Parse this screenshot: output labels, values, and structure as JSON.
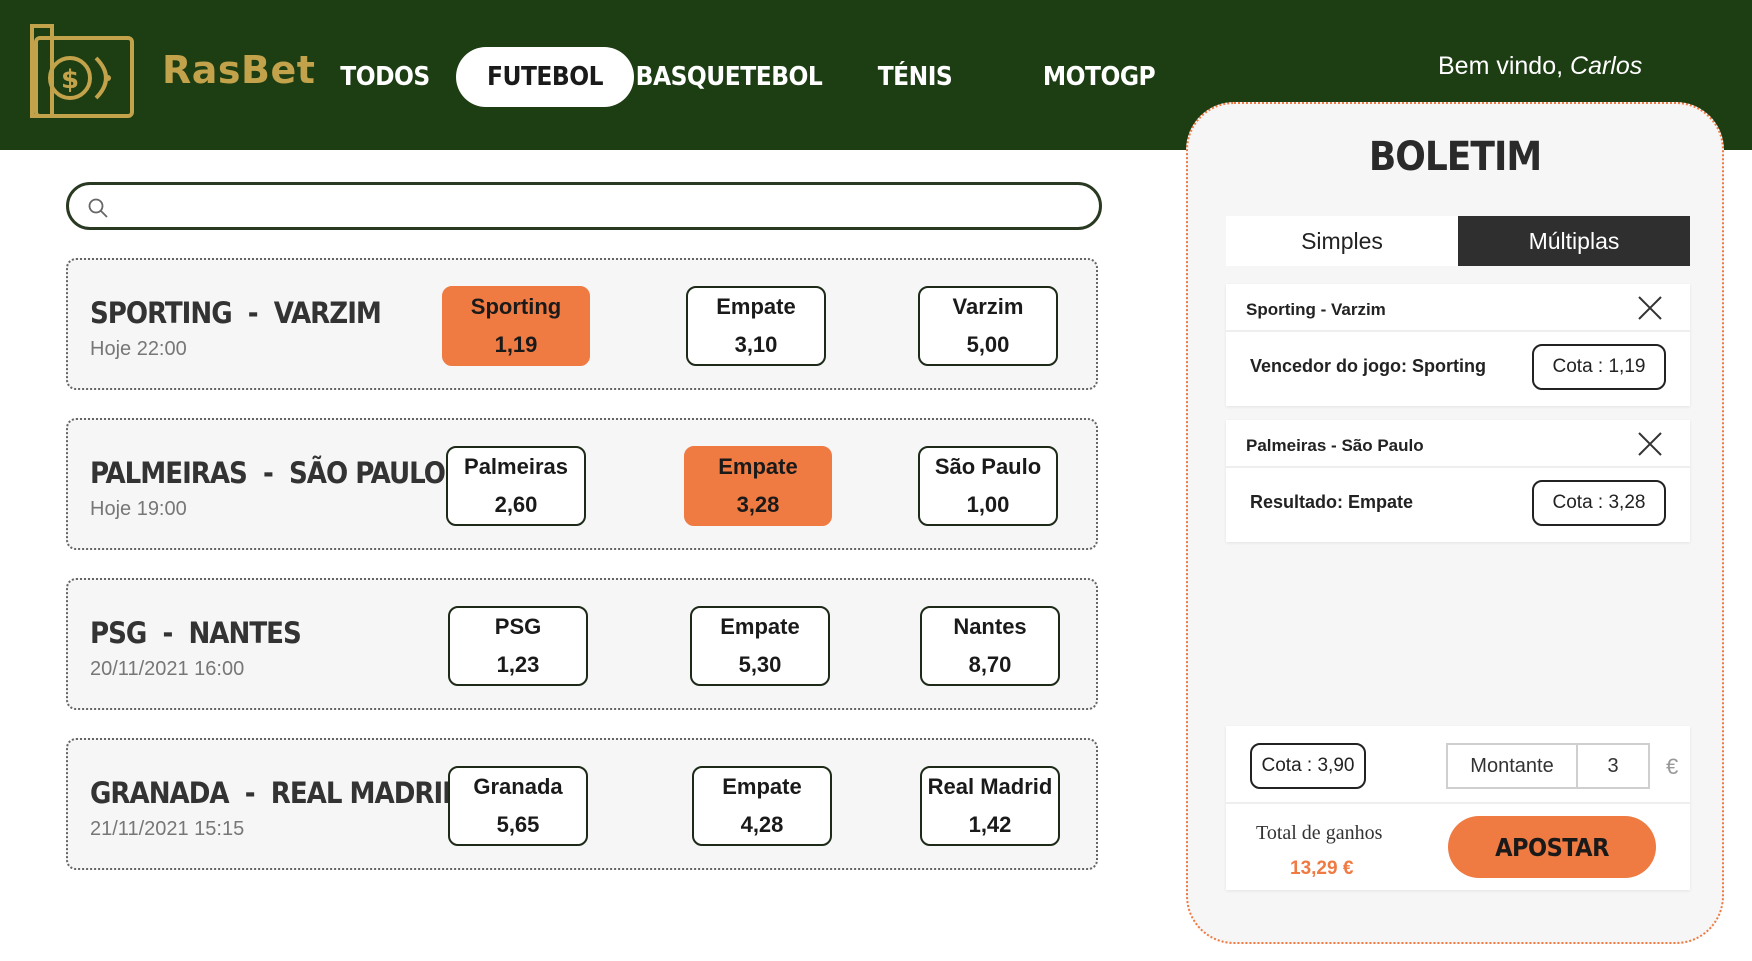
{
  "brand": {
    "name": "RasBet",
    "logo_icon": "money-bill-icon",
    "logo_color": "#c2a24a"
  },
  "colors": {
    "header_bg": "#1d3d13",
    "accent": "#ef7a42",
    "dark": "#2f2f2f"
  },
  "nav": {
    "tabs": [
      {
        "label": "TODOS",
        "active": false
      },
      {
        "label": "FUTEBOL",
        "active": true
      },
      {
        "label": "BASQUETEBOL",
        "active": false
      },
      {
        "label": "TÉNIS",
        "active": false
      },
      {
        "label": "MOTOGP",
        "active": false
      }
    ]
  },
  "welcome": {
    "greeting": "Bem vindo, ",
    "user": "Carlos"
  },
  "search": {
    "placeholder": "",
    "value": "",
    "icon": "search-icon"
  },
  "matches": [
    {
      "home": "SPORTING",
      "away": "VARZIM",
      "date": "Hoje 22:00",
      "odds": [
        {
          "label": "Sporting",
          "value": "1,19",
          "selected": true
        },
        {
          "label": "Empate",
          "value": "3,10",
          "selected": false
        },
        {
          "label": "Varzim",
          "value": "5,00",
          "selected": false
        }
      ]
    },
    {
      "home": "PALMEIRAS",
      "away": "SÃO PAULO",
      "date": "Hoje 19:00",
      "odds": [
        {
          "label": "Palmeiras",
          "value": "2,60",
          "selected": false
        },
        {
          "label": "Empate",
          "value": "3,28",
          "selected": true
        },
        {
          "label": "São Paulo",
          "value": "1,00",
          "selected": false
        }
      ]
    },
    {
      "home": "PSG",
      "away": "NANTES",
      "date": "20/11/2021 16:00",
      "odds": [
        {
          "label": "PSG",
          "value": "1,23",
          "selected": false
        },
        {
          "label": "Empate",
          "value": "5,30",
          "selected": false
        },
        {
          "label": "Nantes",
          "value": "8,70",
          "selected": false
        }
      ]
    },
    {
      "home": "GRANADA",
      "away": "REAL MADRID",
      "date": "21/11/2021 15:15",
      "odds": [
        {
          "label": "Granada",
          "value": "5,65",
          "selected": false
        },
        {
          "label": "Empate",
          "value": "4,28",
          "selected": false
        },
        {
          "label": "Real Madrid",
          "value": "1,42",
          "selected": false
        }
      ]
    }
  ],
  "slip": {
    "title": "BOLETIM",
    "tabs": {
      "simples": "Simples",
      "multiplas": "Múltiplas",
      "active": "multiplas"
    },
    "bets": [
      {
        "match": "Sporting - Varzim",
        "description": "Vencedor do jogo: Sporting",
        "odd": "Cota : 1,19"
      },
      {
        "match": "Palmeiras - São Paulo",
        "description": "Resultado:  Empate",
        "odd": "Cota : 3,28"
      }
    ],
    "total_odd": "Cota : 3,90",
    "stake_label": "Montante",
    "stake_value": "3",
    "currency": "€",
    "gains_label": "Total de ganhos",
    "gains_value": "13,29 €",
    "bet_button": "APOSTAR"
  }
}
